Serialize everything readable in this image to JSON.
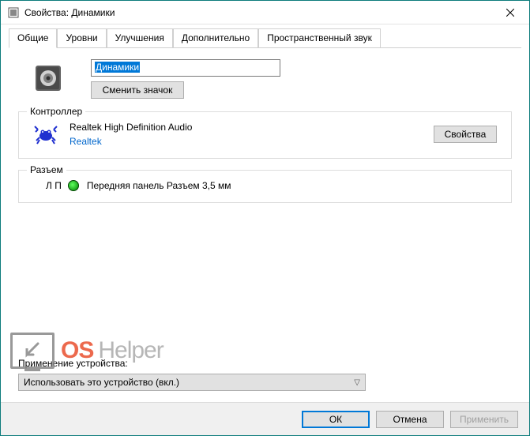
{
  "window": {
    "title": "Свойства: Динамики"
  },
  "tabs": {
    "general": "Общие",
    "levels": "Уровни",
    "enhance": "Улучшения",
    "advanced": "Дополнительно",
    "spatial": "Пространственный звук"
  },
  "device": {
    "name": "Динамики",
    "change_icon": "Сменить значок"
  },
  "controller": {
    "group_title": "Контроллер",
    "name": "Realtek High Definition Audio",
    "vendor": "Realtek",
    "properties_btn": "Свойства"
  },
  "jack": {
    "group_title": "Разъем",
    "lr": "Л П",
    "desc": "Передняя панель Разъем 3,5 мм"
  },
  "usage": {
    "label": "Применение устройства:",
    "selected": "Использовать это устройство (вкл.)"
  },
  "footer": {
    "ok": "ОК",
    "cancel": "Отмена",
    "apply": "Применить"
  },
  "watermark": {
    "os": "OS",
    "helper": "Helper"
  }
}
